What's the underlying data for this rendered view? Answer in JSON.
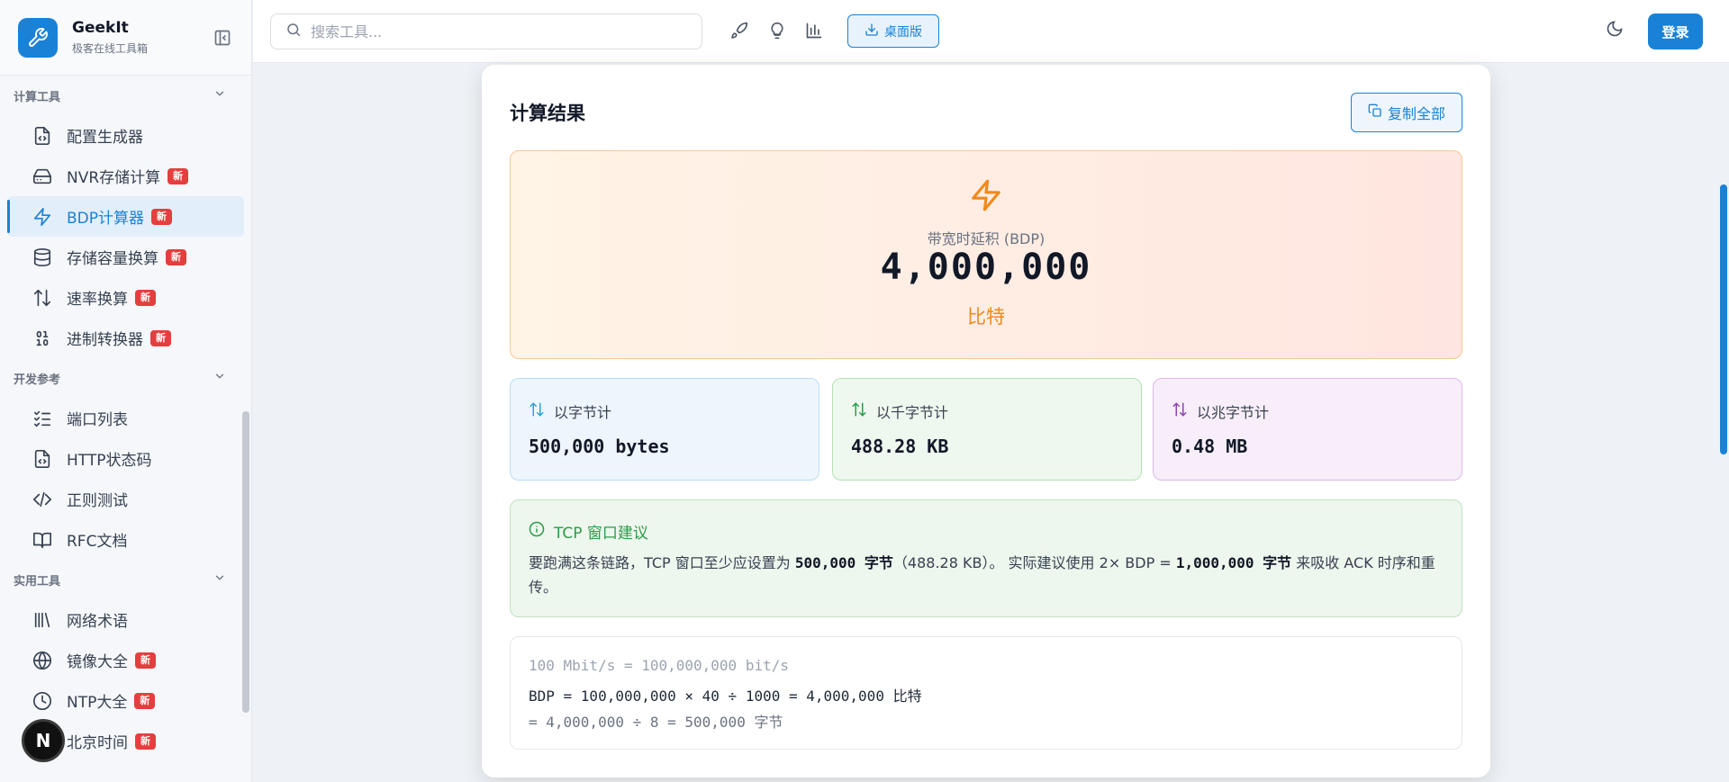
{
  "brand": {
    "name": "GeekIt",
    "subtitle": "极客在线工具箱"
  },
  "sidebar": {
    "groups": [
      {
        "title": "计算工具",
        "items": [
          {
            "label": "配置生成器",
            "icon": "file-code-icon",
            "badge": ""
          },
          {
            "label": "NVR存储计算",
            "icon": "hard-drive-icon",
            "badge": "新"
          },
          {
            "label": "BDP计算器",
            "icon": "zap-icon",
            "badge": "新",
            "active": true
          },
          {
            "label": "存储容量换算",
            "icon": "database-icon",
            "badge": "新"
          },
          {
            "label": "速率换算",
            "icon": "arrow-up-down-icon",
            "badge": "新"
          },
          {
            "label": "进制转换器",
            "icon": "binary-icon",
            "badge": "新"
          }
        ]
      },
      {
        "title": "开发参考",
        "items": [
          {
            "label": "端口列表",
            "icon": "list-checks-icon",
            "badge": ""
          },
          {
            "label": "HTTP状态码",
            "icon": "file-code-icon",
            "badge": ""
          },
          {
            "label": "正则测试",
            "icon": "code-icon",
            "badge": ""
          },
          {
            "label": "RFC文档",
            "icon": "book-open-icon",
            "badge": ""
          }
        ]
      },
      {
        "title": "实用工具",
        "items": [
          {
            "label": "网络术语",
            "icon": "library-icon",
            "badge": ""
          },
          {
            "label": "镜像大全",
            "icon": "globe-icon",
            "badge": "新"
          },
          {
            "label": "NTP大全",
            "icon": "clock-icon",
            "badge": "新"
          },
          {
            "label": "北京时间",
            "icon": "clock-icon",
            "badge": "新"
          }
        ]
      }
    ]
  },
  "topbar": {
    "search_placeholder": "搜索工具...",
    "desktop_label": "桌面版",
    "login_label": "登录"
  },
  "result": {
    "title": "计算结果",
    "copy_all": "复制全部",
    "hero": {
      "label": "带宽时延积 (BDP)",
      "value": "4,000,000",
      "unit": "比特"
    },
    "stats": [
      {
        "label": "以字节计",
        "value": "500,000 bytes",
        "color": "#2aa3d8"
      },
      {
        "label": "以千字节计",
        "value": "488.28 KB",
        "color": "#2e9a4a"
      },
      {
        "label": "以兆字节计",
        "value": "0.48 MB",
        "color": "#8e44ad"
      }
    ],
    "advice": {
      "title": "TCP 窗口建议",
      "p1": "要跑满这条链路，TCP 窗口至少应设置为 ",
      "b1": "500,000 字节",
      "p2": "（488.28 KB）。 实际建议使用 2× BDP = ",
      "b2": "1,000,000 字节",
      "p3": " 来吸收 ACK 时序和重传。"
    },
    "formula": [
      "100 Mbit/s = 100,000,000 bit/s",
      "BDP = 100,000,000 × 40 ÷ 1000 = 4,000,000 比特",
      "= 4,000,000 ÷ 8 = 500,000 字节"
    ]
  },
  "avatar_letter": "N",
  "colors": {
    "accent": "#1a82d6",
    "badge": "#e53e3e",
    "hero_unit": "#f08a1c",
    "advice": "#2e9a4a"
  }
}
